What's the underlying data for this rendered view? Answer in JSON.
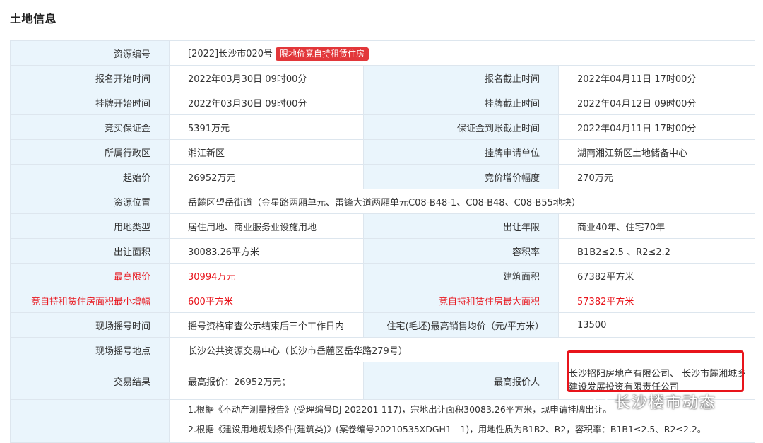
{
  "title": "土地信息",
  "badge": "限地价竞自持租赁住房",
  "rows": {
    "r1": {
      "l1": "资源编号",
      "v1": "[2022]长沙市020号"
    },
    "r2": {
      "l1": "报名开始时间",
      "v1": "2022年03月30日 09时00分",
      "l2": "报名截止时间",
      "v2": "2022年04月11日 17时00分"
    },
    "r3": {
      "l1": "挂牌开始时间",
      "v1": "2022年03月30日 09时00分",
      "l2": "挂牌截止时间",
      "v2": "2022年04月12日 09时00分"
    },
    "r4": {
      "l1": "竞买保证金",
      "v1": "5391万元",
      "l2": "保证金到账截止时间",
      "v2": "2022年04月11日 17时00分"
    },
    "r5": {
      "l1": "所属行政区",
      "v1": "湘江新区",
      "l2": "挂牌申请单位",
      "v2": "湖南湘江新区土地储备中心"
    },
    "r6": {
      "l1": "起始价",
      "v1": "26952万元",
      "l2": "竞价增价幅度",
      "v2": "270万元"
    },
    "r7": {
      "l1": "资源位置",
      "v1": "岳麓区望岳街道（金星路两厢单元、雷锋大道两厢单元C08-B48-1、C08-B48、C08-B55地块）"
    },
    "r8": {
      "l1": "用地类型",
      "v1": "居住用地、商业服务业设施用地",
      "l2": "出让年限",
      "v2": "商业40年、住宅70年"
    },
    "r9": {
      "l1": "出让面积",
      "v1": "30083.26平方米",
      "l2": "容积率",
      "v2": "B1B2≤2.5 、R2≤2.2"
    },
    "r10": {
      "l1": "最高限价",
      "v1": "30994万元",
      "l2": "建筑面积",
      "v2": "67382平方米"
    },
    "r11": {
      "l1": "竞自持租赁住房面积最小增幅",
      "v1": "600平方米",
      "l2": "竞自持租赁住房最大面积",
      "v2": "57382平方米"
    },
    "r12": {
      "l1": "现场摇号时间",
      "v1": "摇号资格审查公示结束后三个工作日内",
      "l2": "住宅(毛坯)最高销售均价（元/平方米）",
      "v2": "13500"
    },
    "r13": {
      "l1": "现场摇号地点",
      "v1": "长沙公共资源交易中心（长沙市岳麓区岳华路279号）"
    },
    "r14": {
      "l1": "交易结果",
      "v1": "最高报价：26952万元；",
      "l2": "最高报价人",
      "v2": "长沙招阳房地产有限公司、 长沙市麓湘城乡建设发展投资有限责任公司"
    }
  },
  "notes": [
    "1.根据《不动产测量报告》(受理编号DJ-202201-117)，宗地出让面积30083.26平方米，现申请挂牌出让。",
    "2.根据《建设用地规划条件(建筑类)》(案卷编号20210535XDGH1 - 1)，用地性质为B1B2、R2，容积率：B1B1≤2.5、R2≤2.2。"
  ],
  "watermark": "长沙楼市动态",
  "colors": {
    "label_bg": "#eaf5fc",
    "border": "#dde6ee",
    "red": "#e8141b",
    "badge": "#e2373a"
  }
}
